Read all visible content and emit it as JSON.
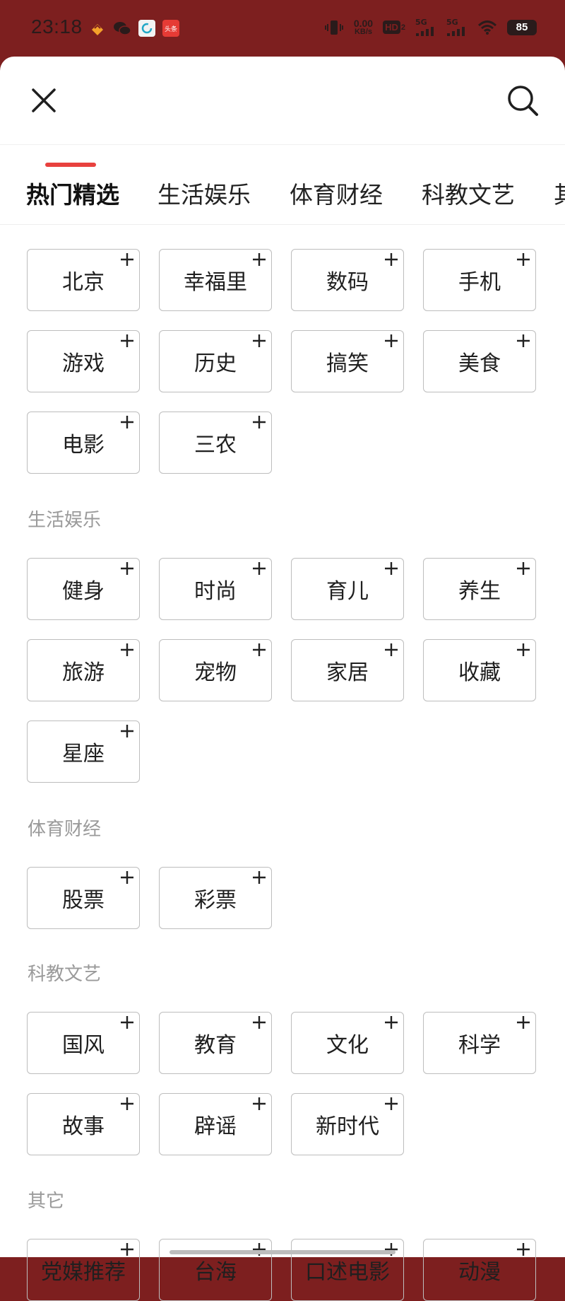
{
  "status_bar": {
    "time": "23:18",
    "net_speed_value": "0.00",
    "net_speed_unit": "KB/s",
    "hd": "HD",
    "hd_sub": "2",
    "signal1": "5G",
    "signal2": "5G",
    "battery": "85",
    "app_icons": [
      "taobao-icon",
      "wechat-icon",
      "refresh-app-icon",
      "toutiao-icon"
    ],
    "toutiao_label": "头条"
  },
  "tabs": [
    {
      "label": "热门精选",
      "active": true
    },
    {
      "label": "生活娱乐",
      "active": false
    },
    {
      "label": "体育财经",
      "active": false
    },
    {
      "label": "科教文艺",
      "active": false
    },
    {
      "label": "其",
      "active": false
    }
  ],
  "accent_color": "#e8413e",
  "sections": [
    {
      "title": "",
      "items": [
        "北京",
        "幸福里",
        "数码",
        "手机",
        "游戏",
        "历史",
        "搞笑",
        "美食",
        "电影",
        "三农"
      ]
    },
    {
      "title": "生活娱乐",
      "items": [
        "健身",
        "时尚",
        "育儿",
        "养生",
        "旅游",
        "宠物",
        "家居",
        "收藏",
        "星座"
      ]
    },
    {
      "title": "体育财经",
      "items": [
        "股票",
        "彩票"
      ]
    },
    {
      "title": "科教文艺",
      "items": [
        "国风",
        "教育",
        "文化",
        "科学",
        "故事",
        "辟谣",
        "新时代"
      ]
    },
    {
      "title": "其它",
      "items": [
        "党媒推荐",
        "台海",
        "口述电影",
        "动漫"
      ]
    }
  ]
}
